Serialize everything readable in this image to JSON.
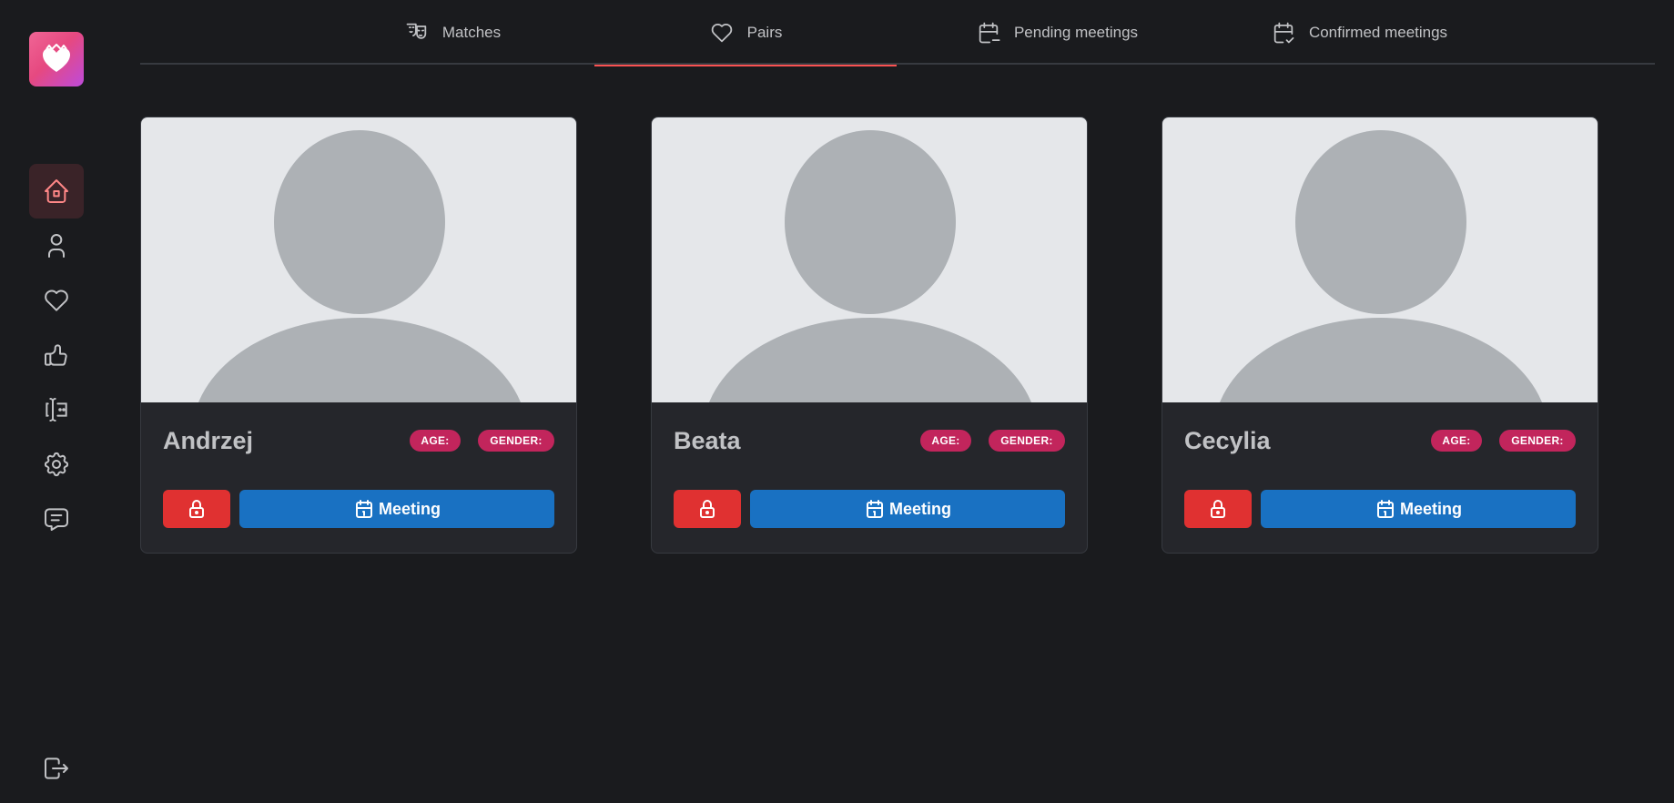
{
  "sidebar": {
    "logo_icon": "heart-logo-icon",
    "nav": [
      {
        "icon": "home-icon",
        "active": true
      },
      {
        "icon": "user-icon"
      },
      {
        "icon": "heart-icon"
      },
      {
        "icon": "thumb-up-icon"
      },
      {
        "icon": "input-cursor-icon"
      },
      {
        "icon": "gear-icon"
      },
      {
        "icon": "message-icon"
      }
    ],
    "logout_icon": "logout-icon"
  },
  "tabs": [
    {
      "label": "Matches",
      "icon": "masks-icon"
    },
    {
      "label": "Pairs",
      "icon": "heart-icon",
      "active": true
    },
    {
      "label": "Pending meetings",
      "icon": "calendar-minus-icon"
    },
    {
      "label": "Confirmed meetings",
      "icon": "calendar-check-icon"
    }
  ],
  "cards": [
    {
      "name": "Andrzej",
      "age_label": "AGE:",
      "gender_label": "GENDER:",
      "meeting_label": "Meeting"
    },
    {
      "name": "Beata",
      "age_label": "AGE:",
      "gender_label": "GENDER:",
      "meeting_label": "Meeting"
    },
    {
      "name": "Cecylia",
      "age_label": "AGE:",
      "gender_label": "GENDER:",
      "meeting_label": "Meeting"
    }
  ],
  "colors": {
    "background": "#1a1b1e",
    "card": "#25262b",
    "accent_red": "#e03131",
    "tab_indicator": "#fa5252",
    "badge": "#c2255c",
    "meeting_button": "#1971c2"
  }
}
